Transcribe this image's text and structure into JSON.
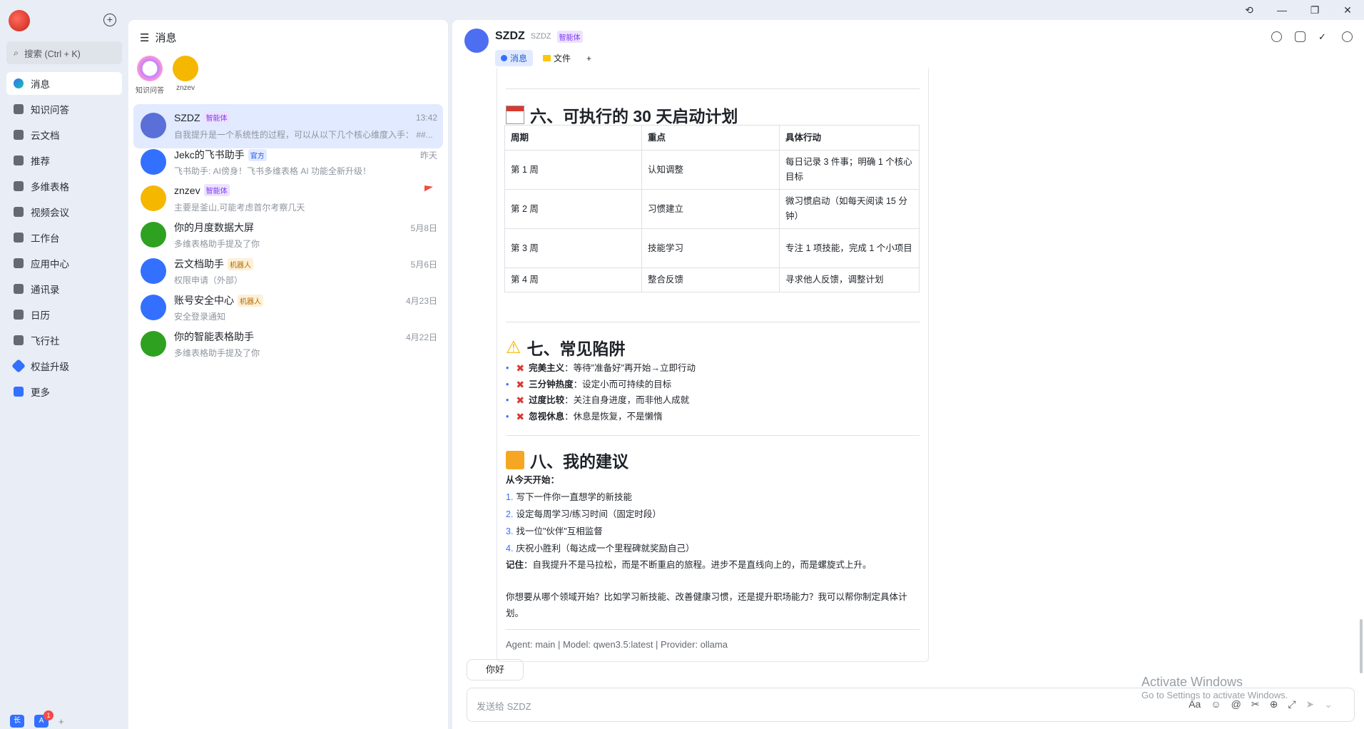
{
  "rail": {
    "search_label": "搜索 (Ctrl + K)",
    "nav": [
      {
        "label": "消息",
        "icon": "message-icon",
        "active": true
      },
      {
        "label": "知识问答",
        "icon": "qa-icon"
      },
      {
        "label": "云文档",
        "icon": "doc-icon"
      },
      {
        "label": "推荐",
        "icon": "recommend-icon"
      },
      {
        "label": "多维表格",
        "icon": "base-icon"
      },
      {
        "label": "视频会议",
        "icon": "video-icon"
      },
      {
        "label": "工作台",
        "icon": "workplace-icon"
      },
      {
        "label": "应用中心",
        "icon": "app-center-icon"
      },
      {
        "label": "通讯录",
        "icon": "contacts-icon"
      },
      {
        "label": "日历",
        "icon": "calendar-icon"
      },
      {
        "label": "飞行社",
        "icon": "club-icon"
      },
      {
        "label": "权益升级",
        "icon": "upgrade-icon"
      },
      {
        "label": "更多",
        "icon": "more-icon"
      }
    ],
    "bottom_badge": "1"
  },
  "list": {
    "title": "消息",
    "pins": [
      {
        "label": "知识问答",
        "color": "#c080ff"
      },
      {
        "label": "znzev",
        "color": "#f5b700"
      }
    ],
    "chats": [
      {
        "name": "SZDZ",
        "tag": "智能体",
        "tag_type": "agent",
        "preview": "自我提升是一个系统性的过程，可以从以下几个核心维度入手：  ##...",
        "time": "13:42",
        "color": "#5a6fd8",
        "active": true
      },
      {
        "name": "Jekc的飞书助手",
        "tag": "官方",
        "tag_type": "official",
        "preview": "飞书助手: AI傍身！飞书多维表格 AI 功能全新升级！",
        "time": "昨天",
        "color": "#3370ff"
      },
      {
        "name": "znzev",
        "tag": "智能体",
        "tag_type": "agent",
        "preview": "主要是釜山,可能考虑首尔考察几天",
        "time": "",
        "color": "#f5b700",
        "flag": true
      },
      {
        "name": "你的月度数据大屏",
        "tag": "",
        "tag_type": "",
        "preview": "多维表格助手提及了你",
        "time": "5月8日",
        "color": "#2ea121"
      },
      {
        "name": "云文档助手",
        "tag": "机器人",
        "tag_type": "bot",
        "preview": "权限申请（外部）",
        "time": "5月6日",
        "color": "#3370ff"
      },
      {
        "name": "账号安全中心",
        "tag": "机器人",
        "tag_type": "bot",
        "preview": "安全登录通知",
        "time": "4月23日",
        "color": "#3370ff"
      },
      {
        "name": "你的智能表格助手",
        "tag": "",
        "tag_type": "",
        "preview": "多维表格助手提及了你",
        "time": "4月22日",
        "color": "#2ea121"
      }
    ]
  },
  "conv": {
    "title": "SZDZ",
    "subtitle": "SZDZ",
    "tag": "智能体",
    "tabs": [
      "消息",
      "文件"
    ],
    "section6": {
      "title": "六、可执行的 30 天启动计划",
      "headers": [
        "周期",
        "重点",
        "具体行动"
      ],
      "rows": [
        [
          "第 1 周",
          "认知调整",
          "每日记录 3 件事；明确 1 个核心目标"
        ],
        [
          "第 2 周",
          "习惯建立",
          "微习惯启动（如每天阅读 15 分钟）"
        ],
        [
          "第 3 周",
          "技能学习",
          "专注 1 项技能，完成 1 个小项目"
        ],
        [
          "第 4 周",
          "整合反馈",
          "寻求他人反馈，调整计划"
        ]
      ]
    },
    "section7": {
      "title": "七、常见陷阱",
      "items": [
        {
          "bold": "完美主义",
          "text": "：等待\"准备好\"再开始→立即行动"
        },
        {
          "bold": "三分钟热度",
          "text": "：设定小而可持续的目标"
        },
        {
          "bold": "过度比较",
          "text": "：关注自身进度，而非他人成就"
        },
        {
          "bold": "忽视休息",
          "text": "：休息是恢复，不是懒惰"
        }
      ]
    },
    "section8": {
      "title": "八、我的建议",
      "lead": "从今天开始：",
      "steps": [
        "写下一件你一直想学的新技能",
        "设定每周学习/练习时间（固定时段）",
        "找一位\"伙伴\"互相监督",
        "庆祝小胜利（每达成一个里程碑就奖励自己）"
      ],
      "remember_bold": "记住",
      "remember": "：自我提升不是马拉松，而是不断重启的旅程。进步不是直线向上的，而是螺旋式上升。",
      "question": "你想要从哪个领域开始？比如学习新技能、改善健康习惯，还是提升职场能力？我可以帮你制定具体计划。"
    },
    "meta": "Agent: main | Model: qwen3.5:latest | Provider: ollama",
    "my_message": "你好",
    "input_placeholder": "发送给 SZDZ",
    "watermark_l1": "Activate Windows",
    "watermark_l2": "Go to Settings to activate Windows."
  }
}
